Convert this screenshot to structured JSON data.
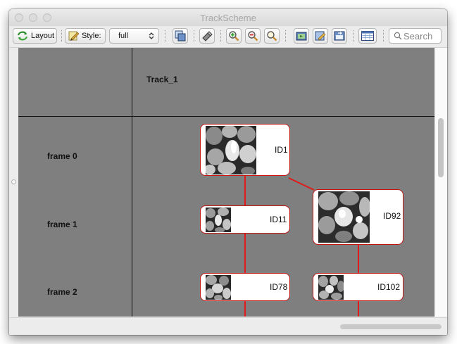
{
  "window": {
    "title": "TrackScheme"
  },
  "toolbar": {
    "layout_label": "Layout",
    "style_label": "Style:",
    "style_value": "full",
    "search_placeholder": "Search",
    "icons": [
      "layout-icon",
      "style-icon",
      "select-all-icon",
      "eraser-icon",
      "zoom-in-icon",
      "zoom-out-icon",
      "zoom-fit-icon",
      "capture-icon",
      "edit-icon",
      "export-icon",
      "table-icon",
      "search-icon"
    ]
  },
  "scheme": {
    "columns": [
      {
        "label": "Track_1"
      }
    ],
    "rows": [
      {
        "label": "frame 0"
      },
      {
        "label": "frame 1"
      },
      {
        "label": "frame 2"
      }
    ],
    "nodes": [
      {
        "id": "ID1"
      },
      {
        "id": "ID11"
      },
      {
        "id": "ID92"
      },
      {
        "id": "ID78"
      },
      {
        "id": "ID102"
      }
    ],
    "edge_color": "#e01b1b",
    "node_border_color": "#c41414"
  }
}
